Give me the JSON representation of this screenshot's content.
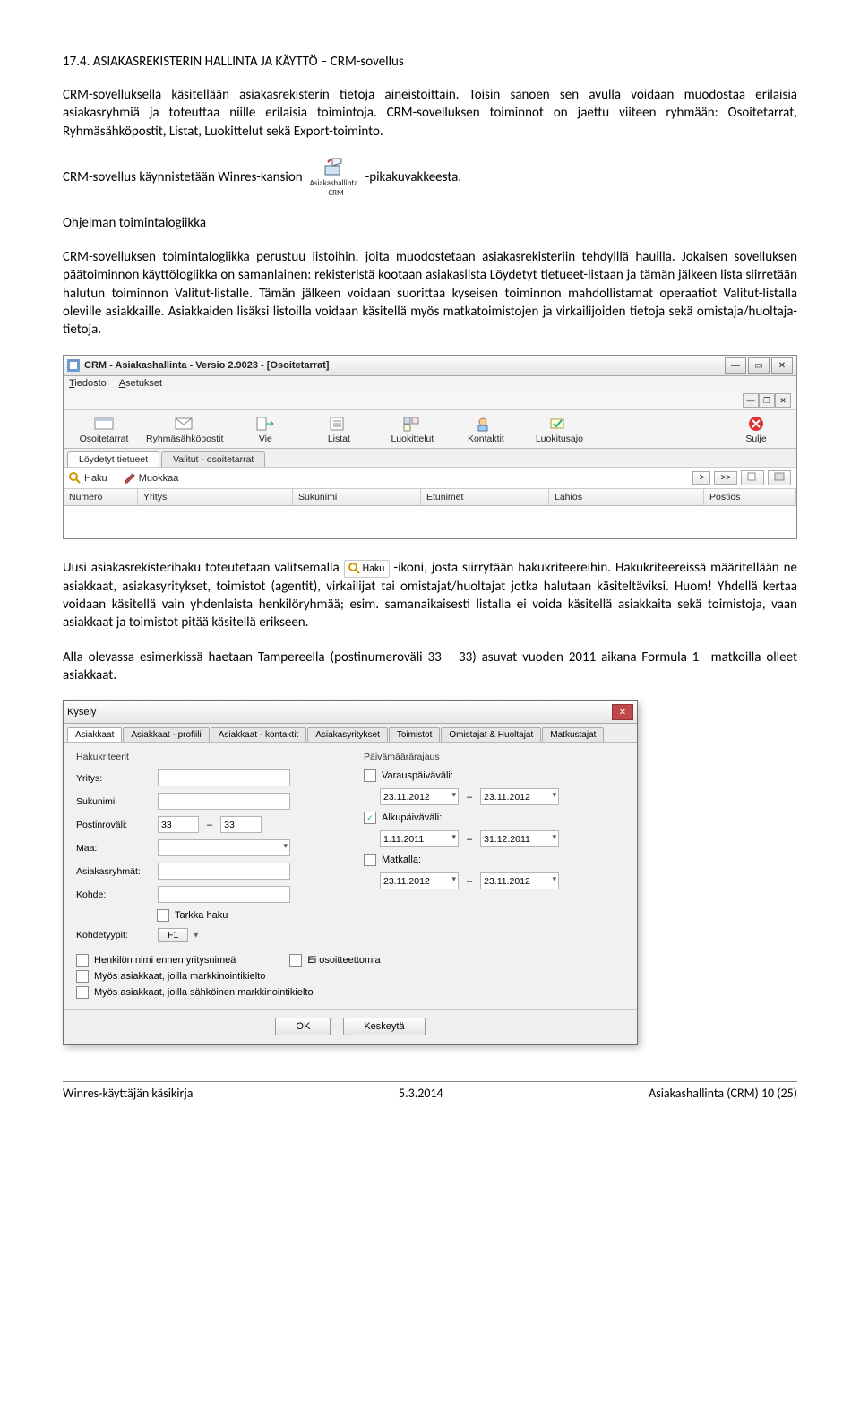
{
  "heading": "17.4. ASIAKASREKISTERIN HALLINTA JA KÄYTTÖ – CRM-sovellus",
  "intro": "CRM-sovelluksella käsitellään asiakasrekisterin tietoja aineistoittain. Toisin sanoen sen avulla voidaan muodostaa erilaisia asiakasryhmiä ja toteuttaa niille erilaisia toimintoja. CRM-sovelluksen toiminnot on jaettu viiteen ryhmään: Osoitetarrat, Ryhmäsähköpostit, Listat, Luokittelut sekä Export-toiminto.",
  "launch_pre": "CRM-sovellus käynnistetään Winres-kansion",
  "launch_post": "-pikakuvakkeesta.",
  "launch_icon_label1": "Asiakashallinta",
  "launch_icon_label2": "- CRM",
  "logic_heading": "Ohjelman toimintalogiikka",
  "logic_para": "CRM-sovelluksen toimintalogiikka perustuu listoihin, joita muodostetaan asiakasrekisteriin tehdyillä hauilla. Jokaisen sovelluksen päätoiminnon käyttölogiikka on samanlainen: rekisteristä kootaan asiakaslista Löydetyt tietueet-listaan ja tämän jälkeen lista siirretään halutun toiminnon Valitut-listalle. Tämän jälkeen voidaan suorittaa kyseisen toiminnon mahdollistamat operaatiot Valitut-listalla oleville asiakkaille. Asiakkaiden lisäksi listoilla voidaan käsitellä myös matkatoimistojen ja virkailijoiden tietoja sekä omistaja/huoltaja-tietoja.",
  "app": {
    "title": "CRM - Asiakashallinta - Versio 2.9023 - [Osoitetarrat]",
    "menu": [
      "Tiedosto",
      "Asetukset"
    ],
    "toolbar": [
      {
        "label": "Osoitetarrat"
      },
      {
        "label": "Ryhmäsähköpostit"
      },
      {
        "label": "Vie"
      },
      {
        "label": "Listat"
      },
      {
        "label": "Luokittelut"
      },
      {
        "label": "Kontaktit"
      },
      {
        "label": "Luokitusajo"
      }
    ],
    "toolbar_right": "Sulje",
    "tabs": [
      "Löydetyt tietueet",
      "Valitut - osoitetarrat"
    ],
    "filter": {
      "haku": "Haku",
      "muokkaa": "Muokkaa",
      "nav1": ">",
      "nav2": ">>"
    },
    "columns": [
      "Numero",
      "Yritys",
      "Sukunimi",
      "Etunimet",
      "Lahios",
      "Postios"
    ]
  },
  "search_para_pre": "Uusi asiakasrekisterihaku toteutetaan valitsemalla",
  "haku_label": "Haku",
  "search_para_post": "-ikoni, josta siirrytään hakukriteereihin. Hakukriteereissä määritellään ne asiakkaat, asiakasyritykset, toimistot (agentit), virkailijat tai omistajat/huoltajat jotka halutaan käsiteltäviksi. Huom! Yhdellä kertaa voidaan käsitellä vain yhdenlaista henkilöryhmää; esim. samanaikaisesti listalla ei voida käsitellä asiakkaita sekä toimistoja, vaan asiakkaat ja toimistot pitää käsitellä erikseen.",
  "example_para": "Alla olevassa esimerkissä haetaan Tampereella (postinumeroväli 33 – 33) asuvat vuoden 2011 aikana Formula 1 –matkoilla olleet asiakkaat.",
  "dialog": {
    "title": "Kysely",
    "tabs": [
      "Asiakkaat",
      "Asiakkaat - profiili",
      "Asiakkaat - kontaktit",
      "Asiakasyritykset",
      "Toimistot",
      "Omistajat & Huoltajat",
      "Matkustajat"
    ],
    "left_group": "Hakukriteerit",
    "right_group": "Päivämäärärajaus",
    "fields": {
      "yritys": "Yritys:",
      "sukunimi": "Sukunimi:",
      "postinrovali": "Postinroväli:",
      "maa": "Maa:",
      "asiakasryhmat": "Asiakasryhmät:",
      "kohde": "Kohde:",
      "tarkka": "Tarkka haku",
      "kohdetyypit": "Kohdetyypit:",
      "kohdetyypit_val": "F1"
    },
    "postinro_from": "33",
    "postinro_to": "33",
    "right": {
      "varaus": "Varauspäiväväli:",
      "alku": "Alkupäiväväli:",
      "matkalla": "Matkalla:",
      "d1a": "23.11.2012",
      "d1b": "23.11.2012",
      "d2a": "1.11.2011",
      "d2b": "31.12.2011",
      "d3a": "23.11.2012",
      "d3b": "23.11.2012"
    },
    "checks": {
      "c1": "Henkilön nimi ennen yritysnimeä",
      "c2": "Ei osoitteettomia",
      "c3": "Myös asiakkaat, joilla markkinointikielto",
      "c4": "Myös asiakkaat, joilla sähköinen markkinointikielto"
    },
    "ok": "OK",
    "cancel": "Keskeytä"
  },
  "footer": {
    "left": "Winres-käyttäjän käsikirja",
    "center": "5.3.2014",
    "right": "Asiakashallinta (CRM)  10 (25)"
  }
}
